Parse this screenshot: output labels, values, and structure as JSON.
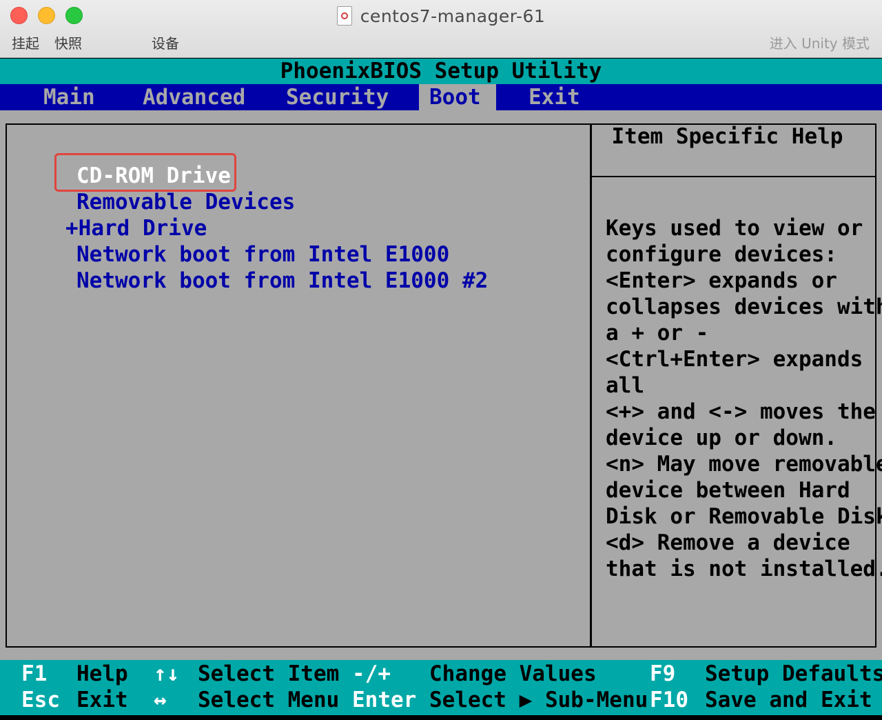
{
  "window": {
    "title": "centos7-manager-61",
    "toolbar": {
      "suspend": "挂起",
      "snapshot": "快照",
      "devices": "设备",
      "unity": "进入 Unity 模式"
    }
  },
  "bios": {
    "title": "PhoenixBIOS Setup Utility",
    "menu": [
      {
        "label": "Main"
      },
      {
        "label": "Advanced"
      },
      {
        "label": "Security"
      },
      {
        "label": "Boot"
      },
      {
        "label": "Exit"
      }
    ],
    "active_menu": "Boot",
    "boot_order": [
      {
        "label": "CD-ROM Drive",
        "selected": true
      },
      {
        "label": "Removable Devices"
      },
      {
        "label": "+Hard Drive"
      },
      {
        "label": "Network boot from Intel E1000"
      },
      {
        "label": "Network boot from Intel E1000 #2"
      }
    ],
    "help": {
      "title": "Item Specific Help",
      "lines": [
        "Keys used to view or",
        "configure devices:",
        "<Enter> expands or",
        "collapses devices with",
        "a + or -",
        "<Ctrl+Enter> expands",
        "all",
        "<+> and <-> moves the",
        "device up or down.",
        "<n> May move removable",
        "device between Hard",
        "Disk or Removable Disk",
        "<d> Remove a device",
        "that is not installed."
      ]
    },
    "footer": {
      "row1": [
        {
          "key": "F1",
          "desc": "Help"
        },
        {
          "key": "↑↓",
          "desc": "Select Item"
        },
        {
          "key": "-/+",
          "desc": "Change Values"
        },
        {
          "key": "F9",
          "desc": "Setup Defaults"
        }
      ],
      "row2": [
        {
          "key": "Esc",
          "desc": "Exit"
        },
        {
          "key": "↔",
          "desc": "Select Menu"
        },
        {
          "key": "Enter",
          "desc": "Select ▶ Sub-Menu"
        },
        {
          "key": "F10",
          "desc": "Save and Exit"
        }
      ]
    },
    "colors": {
      "cyan": "#00a8a8",
      "blue": "#0000a8",
      "gray": "#a8a8a8",
      "highlight": "#e0443e"
    }
  }
}
